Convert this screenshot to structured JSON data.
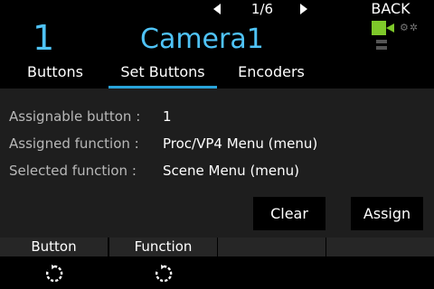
{
  "topbar": {
    "page_indicator": "1/6",
    "back_label": "BACK"
  },
  "header": {
    "camera_number": "1",
    "camera_name": "Camera1",
    "accent_color": "#4fc3f7",
    "rec_color": "#7ec82a"
  },
  "tabs": [
    {
      "label": "Buttons",
      "active": false
    },
    {
      "label": "Set Buttons",
      "active": true
    },
    {
      "label": "Encoders",
      "active": false
    }
  ],
  "details": [
    {
      "label": "Assignable button :",
      "value": "1"
    },
    {
      "label": "Assigned function :",
      "value": "Proc/VP4 Menu (menu)"
    },
    {
      "label": "Selected function :",
      "value": "Scene Menu (menu)"
    }
  ],
  "actions": {
    "clear_label": "Clear",
    "assign_label": "Assign"
  },
  "function_bar": [
    {
      "title": "Button",
      "icon": "rotate-icon"
    },
    {
      "title": "Function",
      "icon": "rotate-icon"
    },
    {
      "title": "",
      "icon": ""
    },
    {
      "title": "",
      "icon": ""
    }
  ]
}
